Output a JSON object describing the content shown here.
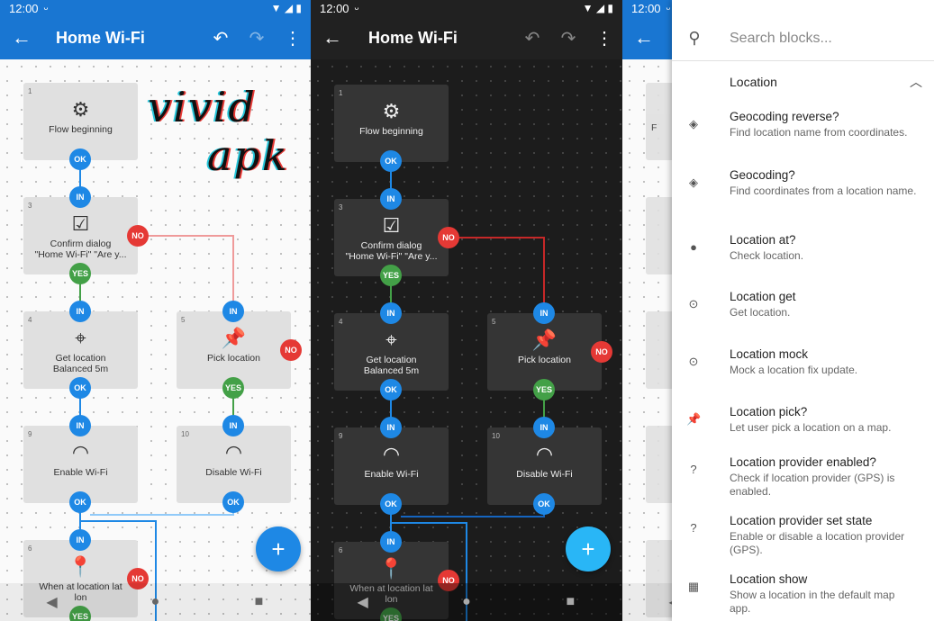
{
  "status": {
    "time": "12:00",
    "face": "ᵕ",
    "icons": "▼ ◢ ▮"
  },
  "panel1": {
    "title": "Home Wi-Fi",
    "back_icon": "←",
    "undo_icon": "↶",
    "redo_icon": "↷",
    "menu_icon": "⋮",
    "watermark_line1": "vivid",
    "watermark_line2": "apk",
    "blocks": [
      {
        "num": "1",
        "icon": "⚙",
        "label": "Flow beginning"
      },
      {
        "num": "3",
        "icon": "☑",
        "label": "Confirm dialog\n\"Home Wi-Fi\" \"Are y..."
      },
      {
        "num": "4",
        "icon": "⌖",
        "label": "Get location\nBalanced 5m"
      },
      {
        "num": "5",
        "icon": "📌",
        "label": "Pick location"
      },
      {
        "num": "9",
        "icon": "◠",
        "label": "Enable Wi-Fi"
      },
      {
        "num": "10",
        "icon": "◠",
        "label": "Disable Wi-Fi"
      },
      {
        "num": "6",
        "icon": "📍",
        "label": "When at location lat\nlon"
      }
    ],
    "dots": {
      "ok": "OK",
      "in": "IN",
      "yes": "YES",
      "no": "NO"
    },
    "fab": "+"
  },
  "panel2": {
    "title": "Home Wi-Fi",
    "blocks": [
      {
        "num": "1",
        "icon": "⚙",
        "label": "Flow beginning"
      },
      {
        "num": "3",
        "icon": "☑",
        "label": "Confirm dialog\n\"Home Wi-Fi\" \"Are y..."
      },
      {
        "num": "4",
        "icon": "⌖",
        "label": "Get location\nBalanced 5m"
      },
      {
        "num": "5",
        "icon": "📌",
        "label": "Pick location"
      },
      {
        "num": "9",
        "icon": "◠",
        "label": "Enable Wi-Fi"
      },
      {
        "num": "10",
        "icon": "◠",
        "label": "Disable Wi-Fi"
      },
      {
        "num": "6",
        "icon": "📍",
        "label": "When at location lat\nlon"
      }
    ]
  },
  "panel3": {
    "search_placeholder": "Search blocks...",
    "section_title": "Location",
    "items": [
      {
        "icon": "◈",
        "title": "Geocoding reverse?",
        "desc": "Find location name from coordinates."
      },
      {
        "icon": "◈",
        "title": "Geocoding?",
        "desc": "Find coordinates from a location name."
      },
      {
        "icon": "●",
        "title": "Location at?",
        "desc": "Check location."
      },
      {
        "icon": "⊙",
        "title": "Location get",
        "desc": "Get location."
      },
      {
        "icon": "⊙",
        "title": "Location mock",
        "desc": "Mock a location fix update."
      },
      {
        "icon": "📌",
        "title": "Location pick?",
        "desc": "Let user pick a location on a map."
      },
      {
        "icon": "?",
        "title": "Location provider enabled?",
        "desc": "Check if location provider (GPS) is enabled."
      },
      {
        "icon": "?",
        "title": "Location provider set state",
        "desc": "Enable or disable a location provider (GPS)."
      },
      {
        "icon": "▦",
        "title": "Location show",
        "desc": "Show a location in the default map app."
      }
    ],
    "bg_labels": [
      "F",
      "",
      "\"Ho",
      "",
      "",
      ""
    ]
  },
  "nav": {
    "back": "◀",
    "home": "●",
    "recents": "■"
  },
  "colors": {
    "primary": "#1976d2",
    "ok": "#1e88e5",
    "yes": "#43a047",
    "no": "#e53935"
  }
}
